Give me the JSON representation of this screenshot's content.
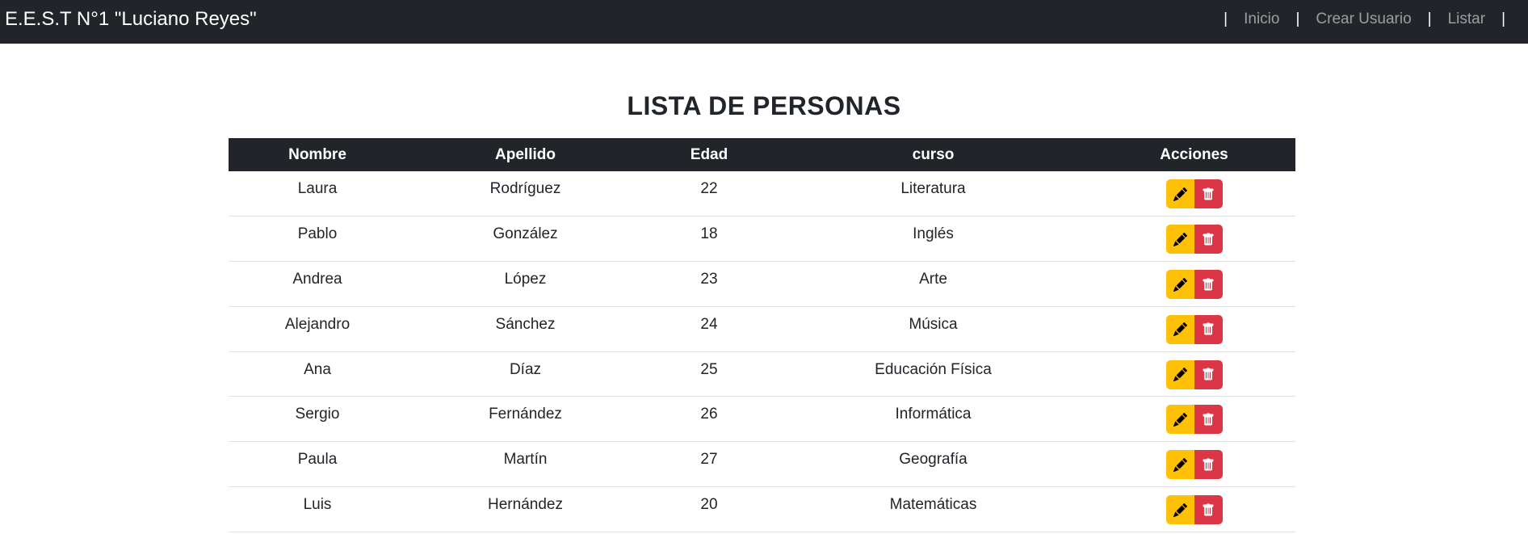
{
  "navbar": {
    "brand": "E.E.S.T N°1 \"Luciano Reyes\"",
    "links": [
      {
        "label": "Inicio"
      },
      {
        "label": "Crear Usuario"
      },
      {
        "label": "Listar"
      }
    ],
    "separator": "|"
  },
  "page": {
    "title": "LISTA DE PERSONAS"
  },
  "table": {
    "headers": [
      "Nombre",
      "Apellido",
      "Edad",
      "curso",
      "Acciones"
    ],
    "rows": [
      {
        "nombre": "Laura",
        "apellido": "Rodríguez",
        "edad": "22",
        "curso": "Literatura"
      },
      {
        "nombre": "Pablo",
        "apellido": "González",
        "edad": "18",
        "curso": "Inglés"
      },
      {
        "nombre": "Andrea",
        "apellido": "López",
        "edad": "23",
        "curso": "Arte"
      },
      {
        "nombre": "Alejandro",
        "apellido": "Sánchez",
        "edad": "24",
        "curso": "Música"
      },
      {
        "nombre": "Ana",
        "apellido": "Díaz",
        "edad": "25",
        "curso": "Educación Física"
      },
      {
        "nombre": "Sergio",
        "apellido": "Fernández",
        "edad": "26",
        "curso": "Informática"
      },
      {
        "nombre": "Paula",
        "apellido": "Martín",
        "edad": "27",
        "curso": "Geografía"
      },
      {
        "nombre": "Luis",
        "apellido": "Hernández",
        "edad": "20",
        "curso": "Matemáticas"
      }
    ],
    "actions": {
      "edit_icon": "pencil-icon",
      "delete_icon": "trash-icon",
      "edit_color": "#ffc107",
      "delete_color": "#dc3545"
    }
  },
  "colors": {
    "navbar_bg": "#212529",
    "header_bg": "#212529"
  }
}
